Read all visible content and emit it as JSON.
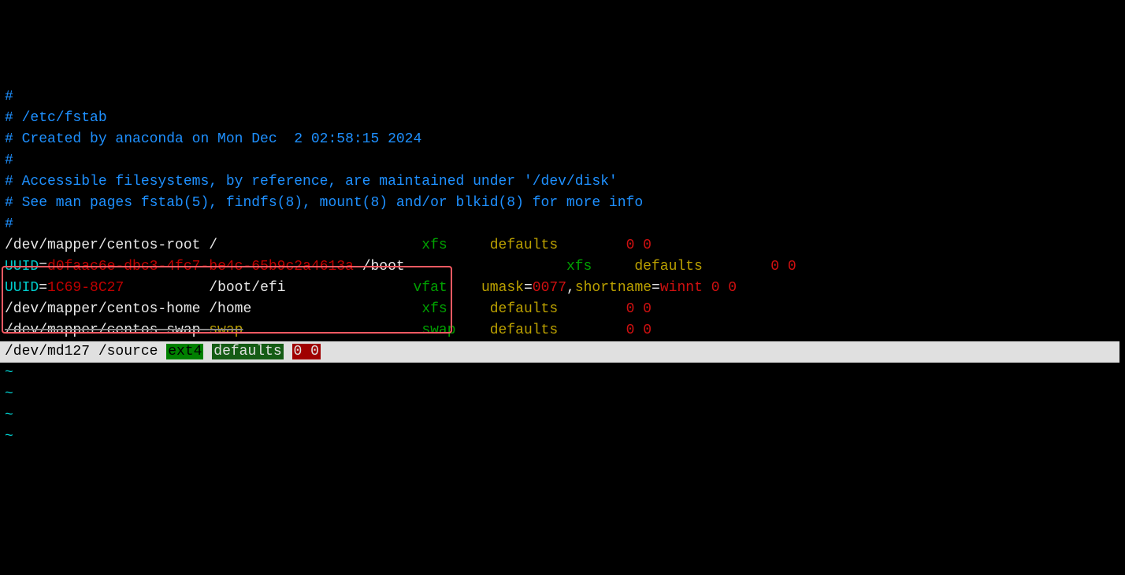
{
  "comments": {
    "l0": "#",
    "l1": "# /etc/fstab",
    "l2": "# Created by anaconda on Mon Dec  2 02:58:15 2024",
    "l3": "#",
    "l4": "# Accessible filesystems, by reference, are maintained under '/dev/disk'",
    "l5": "# See man pages fstab(5), findfs(8), mount(8) and/or blkid(8) for more info",
    "l6": "#"
  },
  "row_root": {
    "dev": "/dev/mapper/centos-root /",
    "sp1": "                        ",
    "fs": "xfs",
    "sp2": "     ",
    "opts": "defaults",
    "sp3": "        ",
    "dump": "0 0"
  },
  "row_boot": {
    "uuid_key": "UUID",
    "eq": "=",
    "uuid_val": "d0faac6e-dbc3-4fc7-be4c-65b9c2a4613a",
    "mnt": " /boot",
    "sp1": "                   ",
    "fs": "xfs",
    "sp2": "     ",
    "opts": "defaults",
    "sp3": "        ",
    "dump": "0 0"
  },
  "row_efi": {
    "uuid_key": "UUID",
    "eq": "=",
    "uuid_val": "1C69-8C27",
    "sp0": "          ",
    "mnt": "/boot/efi",
    "sp1": "               ",
    "fs": "vfat",
    "sp2": "    ",
    "opt_umask_k": "umask",
    "opt_eq": "=",
    "opt_umask_v": "0077",
    "opt_comma": ",",
    "opt_short_k": "shortname",
    "opt_eq2": "=",
    "opt_short_v": "winnt",
    "sp3": " ",
    "dump": "0 0"
  },
  "row_home": {
    "dev": "/dev/mapper/centos-home /home",
    "sp1": "                    ",
    "fs": "xfs",
    "sp2": "     ",
    "opts": "defaults",
    "sp3": "        ",
    "dump": "0 0"
  },
  "row_swap": {
    "dev": "/dev/mapper/centos-swap ",
    "swap1": "swap",
    "sp1": "                     ",
    "fs": "swap",
    "sp2": "    ",
    "opts": "defaults",
    "sp3": "        ",
    "dump": "0 0"
  },
  "row_new": {
    "dev": "/dev/md127 /source ",
    "fs": "ext4",
    "sp1": " ",
    "opts": "defaults",
    "sp2": " ",
    "dump": "0 0"
  },
  "tilde": "~"
}
